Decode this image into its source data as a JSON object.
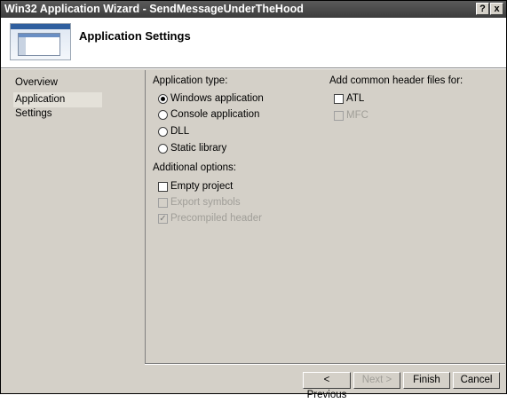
{
  "window": {
    "title": "Win32 Application Wizard - SendMessageUnderTheHood",
    "help_label": "?",
    "close_label": "x"
  },
  "header": {
    "title": "Application Settings"
  },
  "nav": {
    "items": [
      {
        "label": "Overview",
        "selected": false
      },
      {
        "label": "Application Settings",
        "selected": true
      }
    ]
  },
  "application_type": {
    "label": "Application type:",
    "options": [
      {
        "label": "Windows application",
        "selected": true
      },
      {
        "label": "Console application",
        "selected": false
      },
      {
        "label": "DLL",
        "selected": false
      },
      {
        "label": "Static library",
        "selected": false
      }
    ]
  },
  "additional_options": {
    "label": "Additional options:",
    "options": [
      {
        "label": "Empty project",
        "checked": false,
        "enabled": true
      },
      {
        "label": "Export symbols",
        "checked": false,
        "enabled": false
      },
      {
        "label": "Precompiled header",
        "checked": true,
        "enabled": false
      }
    ]
  },
  "common_headers": {
    "label": "Add common header files for:",
    "options": [
      {
        "label": "ATL",
        "checked": false,
        "enabled": true
      },
      {
        "label": "MFC",
        "checked": false,
        "enabled": false
      }
    ]
  },
  "buttons": {
    "previous": "< Previous",
    "next": "Next >",
    "finish": "Finish",
    "cancel": "Cancel"
  },
  "checkmark_glyph": "✓"
}
